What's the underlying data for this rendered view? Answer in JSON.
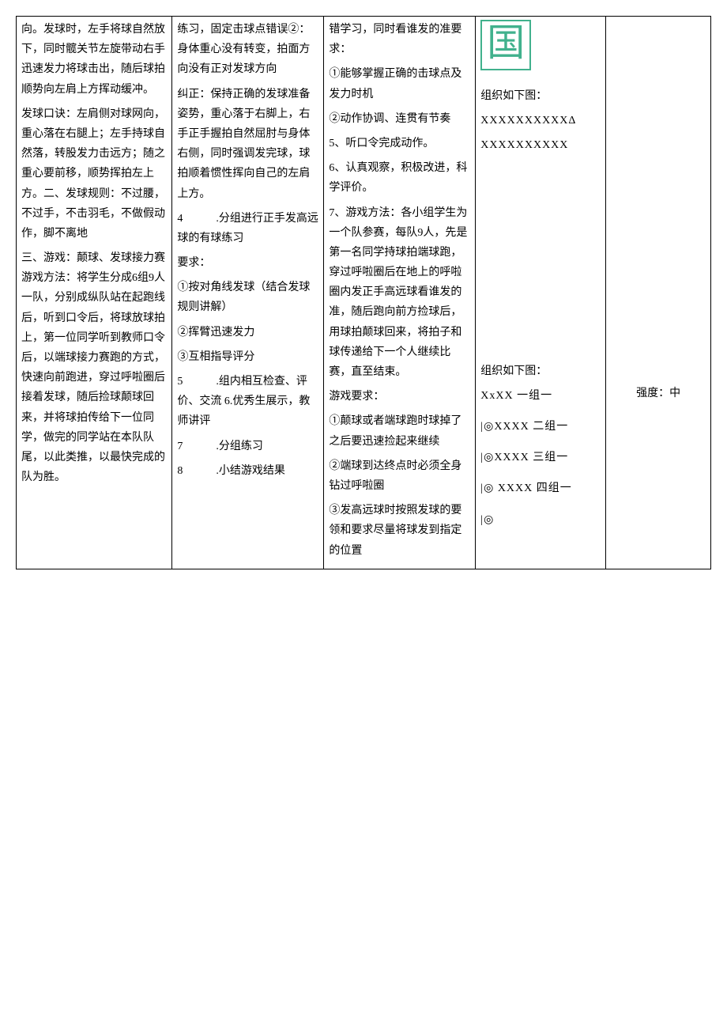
{
  "col1": {
    "p1": "向。发球时，左手将球自然放下，同时髋关节左旋带动右手迅速发力将球击出，随后球拍顺势向左肩上方挥动缓冲。",
    "p2": "发球口诀：左肩侧对球网向，重心落在右腿上；左手持球自然落，转股发力击远方；随之重心要前移，顺势挥拍左上方。二、发球规则：不过腰，不过手，不击羽毛，不做假动作，脚不离地",
    "p3": "三、游戏：颠球、发球接力赛游戏方法：将学生分成6组9人一队，分别成纵队站在起跑线后，听到口令后，将球放球拍上，第一位同学听到教师口令后，以端球接力赛跑的方式，快速向前跑进，穿过呼啦圈后接着发球，随后捡球颠球回来，并将球拍传给下一位同学，做完的同学站在本队队尾，以此类推，以最快完成的队为胜。"
  },
  "col2": {
    "p1": "练习，固定击球点错误②：身体重心没有转变，拍面方向没有正对发球方向",
    "p2": "纠正：保持正确的发球准备姿势，重心落于右脚上，右手正手握拍自然屈肘与身体右侧，同时强调发完球，球拍顺着惯性挥向自己的左肩上方。",
    "p3_label": "4",
    "p3_text": ".分组进行正手发高远球的有球练习",
    "p4": "要求：",
    "p5": "①按对角线发球（结合发球规则讲解）",
    "p6": "②挥臂迅速发力",
    "p7": "③互相指导评分",
    "p8_label": "5",
    "p8_text": ".组内相互检查、评价、交流 6.优秀生展示，教师讲评",
    "p9_label": "7",
    "p9_text": ".分组练习",
    "p10_label": "8",
    "p10_text": ".小结游戏结果"
  },
  "col3": {
    "p1": "错学习，同时看谁发的准要求：",
    "p2": "①能够掌握正确的击球点及发力时机",
    "p3": "②动作协调、连贯有节奏",
    "p4": "5、听口令完成动作。",
    "p5": "6、认真观察，积极改进，科学评价。",
    "p6": "7、游戏方法：各小组学生为一个队参赛，每队9人，先是第一名同学持球拍端球跑，穿过呼啦圈后在地上的呼啦圈内发正手高远球看谁发的准，随后跑向前方捡球后，用球拍颠球回来，将拍子和球传递给下一个人继续比赛，直至结束。",
    "p7": "游戏要求：",
    "p8": "①颠球或者端球跑时球掉了之后要迅速捡起来继续",
    "p9": "②端球到达终点时必须全身钻过呼啦圈",
    "p10": "③发高远球时按照发球的要领和要求尽量将球发到指定的位置"
  },
  "col4": {
    "guo": "国",
    "org1_label": "组织如下图：",
    "org1_line1": "XXXXXXXXXXΔ",
    "org1_line2": "XXXXXXXXXX",
    "org2_label": "组织如下图：",
    "g1": "XxXX 一组一",
    "g2": "|◎XXXX 二组一",
    "g3": "|◎XXXX 三组一",
    "g4": "|◎ XXXX 四组一",
    "g5": "|◎"
  },
  "col5": {
    "intensity": "强度：中"
  }
}
